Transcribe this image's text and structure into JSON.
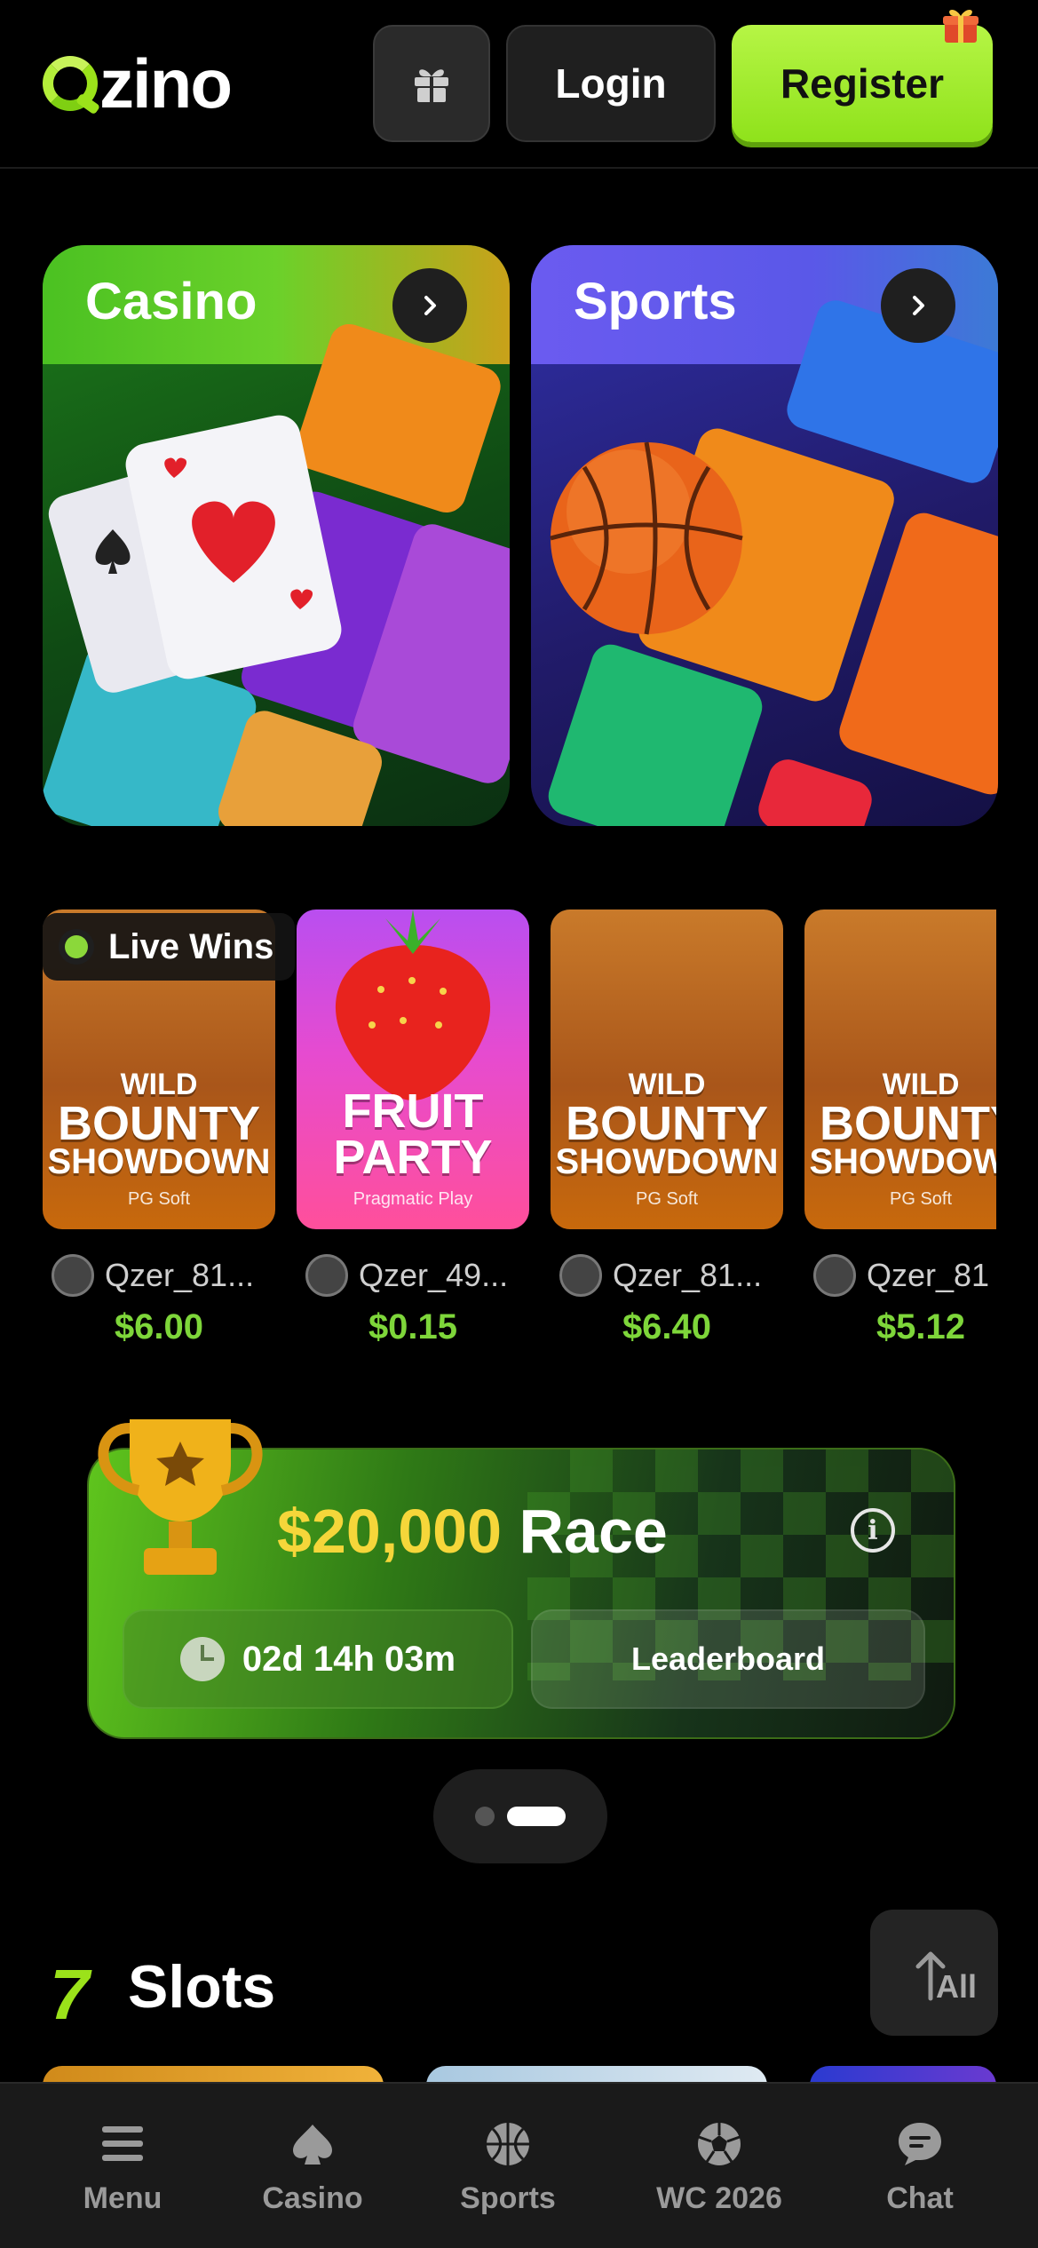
{
  "header": {
    "logo_text": "zino",
    "login_label": "Login",
    "register_label": "Register"
  },
  "categories": [
    {
      "title": "Casino"
    },
    {
      "title": "Sports"
    }
  ],
  "live_wins": {
    "badge_label": "Live Wins",
    "items": [
      {
        "game_line1": "WILD",
        "game_line2": "BOUNTY",
        "game_line3": "SHOWDOWN",
        "provider": "PG Soft",
        "user": "Qzer_81...",
        "amount": "$6.00"
      },
      {
        "game_line1": "FRUIT",
        "game_line2": "PARTY",
        "game_line3": "",
        "provider": "Pragmatic Play",
        "user": "Qzer_49...",
        "amount": "$0.15"
      },
      {
        "game_line1": "WILD",
        "game_line2": "BOUNTY",
        "game_line3": "SHOWDOWN",
        "provider": "PG Soft",
        "user": "Qzer_81...",
        "amount": "$6.40"
      },
      {
        "game_line1": "WILD",
        "game_line2": "BOUNTY",
        "game_line3": "SHOWDOWN",
        "provider": "PG Soft",
        "user": "Qzer_81",
        "amount": "$5.12"
      }
    ]
  },
  "race": {
    "amount": "$20,000",
    "label": "Race",
    "info_glyph": "i",
    "timer": "02d 14h 03m",
    "leaderboard_label": "Leaderboard"
  },
  "slots": {
    "seven": "7",
    "title": "Slots",
    "all_label": "All"
  },
  "bottom_nav": [
    {
      "label": "Menu",
      "icon": "menu-icon"
    },
    {
      "label": "Casino",
      "icon": "spade-icon"
    },
    {
      "label": "Sports",
      "icon": "basketball-icon"
    },
    {
      "label": "WC 2026",
      "icon": "soccer-ball-icon"
    },
    {
      "label": "Chat",
      "icon": "chat-icon"
    }
  ],
  "colors": {
    "accent_green": "#9be21a",
    "amount_green": "#7ed63a",
    "race_gold": "#f5d63a"
  }
}
